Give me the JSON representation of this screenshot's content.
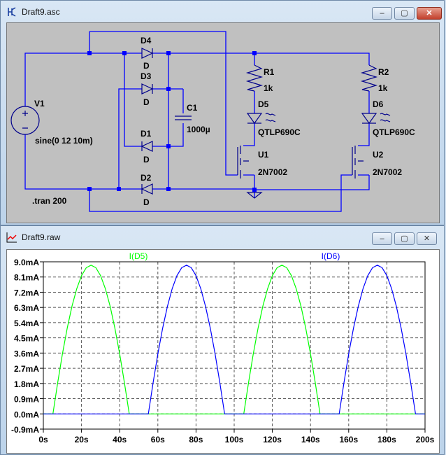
{
  "schematic_window": {
    "title": "Draft9.asc",
    "components": {
      "V1": {
        "name": "V1",
        "value": "sine(0 12 10m)"
      },
      "D1": {
        "name": "D1",
        "value": "D"
      },
      "D2": {
        "name": "D2",
        "value": "D"
      },
      "D3": {
        "name": "D3",
        "value": "D"
      },
      "D4": {
        "name": "D4",
        "value": "D"
      },
      "C1": {
        "name": "C1",
        "value": "1000µ"
      },
      "R1": {
        "name": "R1",
        "value": "1k"
      },
      "R2": {
        "name": "R2",
        "value": "1k"
      },
      "D5": {
        "name": "D5",
        "value": "QTLP690C"
      },
      "D6": {
        "name": "D6",
        "value": "QTLP690C"
      },
      "U1": {
        "name": "U1",
        "value": "2N7002"
      },
      "U2": {
        "name": "U2",
        "value": "2N7002"
      }
    },
    "directive": ".tran 200",
    "wire_color": "#0000ff",
    "background": "#c0c0c0"
  },
  "plot_window": {
    "title": "Draft9.raw"
  },
  "window_buttons": {
    "minimize": "–",
    "maximize": "▢",
    "close": "✕"
  },
  "chart_data": {
    "type": "line",
    "xlabel": "",
    "ylabel": "",
    "xlim": [
      0,
      200
    ],
    "ylim": [
      -0.9,
      9.0
    ],
    "x_ticks": [
      "0s",
      "20s",
      "40s",
      "60s",
      "80s",
      "100s",
      "120s",
      "140s",
      "160s",
      "180s",
      "200s"
    ],
    "y_ticks": [
      "9.0mA",
      "8.1mA",
      "7.2mA",
      "6.3mA",
      "5.4mA",
      "4.5mA",
      "3.6mA",
      "2.7mA",
      "1.8mA",
      "0.9mA",
      "0.0mA",
      "-0.9mA"
    ],
    "grid": true,
    "x": [
      0,
      2.5,
      5,
      7.5,
      10,
      12.5,
      15,
      17.5,
      20,
      22.5,
      25,
      27.5,
      30,
      32.5,
      35,
      37.5,
      40,
      42.5,
      45,
      47.5,
      50,
      52.5,
      55,
      57.5,
      60,
      62.5,
      65,
      67.5,
      70,
      72.5,
      75,
      77.5,
      80,
      82.5,
      85,
      87.5,
      90,
      92.5,
      95,
      97.5,
      100,
      102.5,
      105,
      107.5,
      110,
      112.5,
      115,
      117.5,
      120,
      122.5,
      125,
      127.5,
      130,
      132.5,
      135,
      137.5,
      140,
      142.5,
      145,
      147.5,
      150,
      152.5,
      155,
      157.5,
      160,
      162.5,
      165,
      167.5,
      170,
      172.5,
      175,
      177.5,
      180,
      182.5,
      185,
      187.5,
      190,
      192.5,
      195,
      197.5,
      200
    ],
    "series": [
      {
        "name": "I(D5)",
        "color": "#00ff00",
        "values": [
          0,
          0,
          0,
          1.84,
          3.55,
          5.06,
          6.36,
          7.41,
          8.18,
          8.65,
          8.8,
          8.65,
          8.18,
          7.41,
          6.36,
          5.06,
          3.55,
          1.84,
          0,
          0,
          0,
          0,
          0,
          0,
          0,
          0,
          0,
          0,
          0,
          0,
          0,
          0,
          0,
          0,
          0,
          0,
          0,
          0,
          0,
          0,
          0,
          0,
          0,
          1.84,
          3.55,
          5.06,
          6.36,
          7.41,
          8.18,
          8.65,
          8.8,
          8.65,
          8.18,
          7.41,
          6.36,
          5.06,
          3.55,
          1.84,
          0,
          0,
          0,
          0,
          0,
          0,
          0,
          0,
          0,
          0,
          0,
          0,
          0,
          0,
          0,
          0,
          0,
          0,
          0,
          0,
          0,
          0,
          0
        ]
      },
      {
        "name": "I(D6)",
        "color": "#0000ff",
        "values": [
          0,
          0,
          0,
          0,
          0,
          0,
          0,
          0,
          0,
          0,
          0,
          0,
          0,
          0,
          0,
          0,
          0,
          0,
          0,
          0,
          0,
          0,
          0,
          1.84,
          3.55,
          5.06,
          6.36,
          7.41,
          8.18,
          8.65,
          8.8,
          8.65,
          8.18,
          7.41,
          6.36,
          5.06,
          3.55,
          1.84,
          0,
          0,
          0,
          0,
          0,
          0,
          0,
          0,
          0,
          0,
          0,
          0,
          0,
          0,
          0,
          0,
          0,
          0,
          0,
          0,
          0,
          0,
          0,
          0,
          0,
          1.84,
          3.55,
          5.06,
          6.36,
          7.41,
          8.18,
          8.65,
          8.8,
          8.65,
          8.18,
          7.41,
          6.36,
          5.06,
          3.55,
          1.84,
          0,
          0,
          0
        ]
      }
    ]
  }
}
